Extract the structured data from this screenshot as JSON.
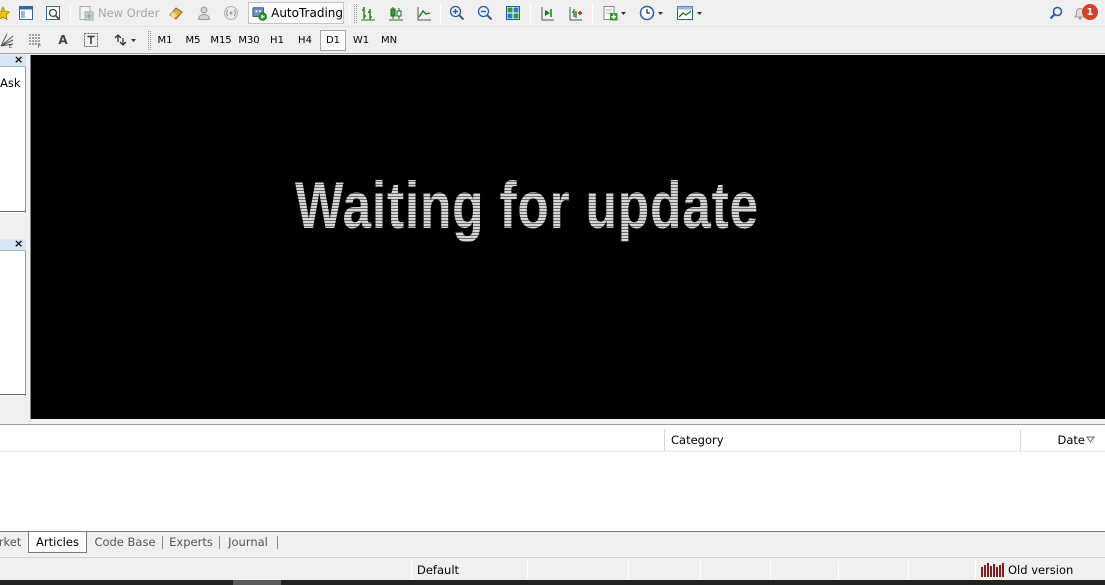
{
  "toolbar_main": {
    "new_order_label": "New Order",
    "autotrading_label": "AutoTrading",
    "notification_count": "1",
    "icons": [
      "star-icon",
      "window-icon",
      "zoom-window-icon",
      "new-order-icon",
      "eraser-icon",
      "person-icon",
      "signal-icon",
      "autotrading-icon",
      "bar-chart-icon",
      "candle-chart-icon",
      "line-chart-icon",
      "zoom-in-icon",
      "zoom-out-icon",
      "tile-icon",
      "autoscroll-icon",
      "chart-shift-icon",
      "add-indicator-icon",
      "clock-icon",
      "template-icon",
      "search-icon",
      "bell-icon"
    ]
  },
  "toolbar_timeframes": {
    "timeframes": [
      "M1",
      "M5",
      "M15",
      "M30",
      "H1",
      "H4",
      "D1",
      "W1",
      "MN"
    ],
    "active": "D1",
    "text_tool_label": "A"
  },
  "market_watch": {
    "ask_label": "Ask"
  },
  "chart": {
    "message": "Waiting for update",
    "background": "#000000"
  },
  "terminal": {
    "columns": [
      "Category",
      "Date"
    ],
    "tabs": [
      "rket",
      "Articles",
      "Code Base",
      "Experts",
      "Journal"
    ],
    "active_tab": "Articles"
  },
  "status_bar": {
    "profile": "Default",
    "version_label": "Old version",
    "version_color": "#8b1a1a"
  }
}
